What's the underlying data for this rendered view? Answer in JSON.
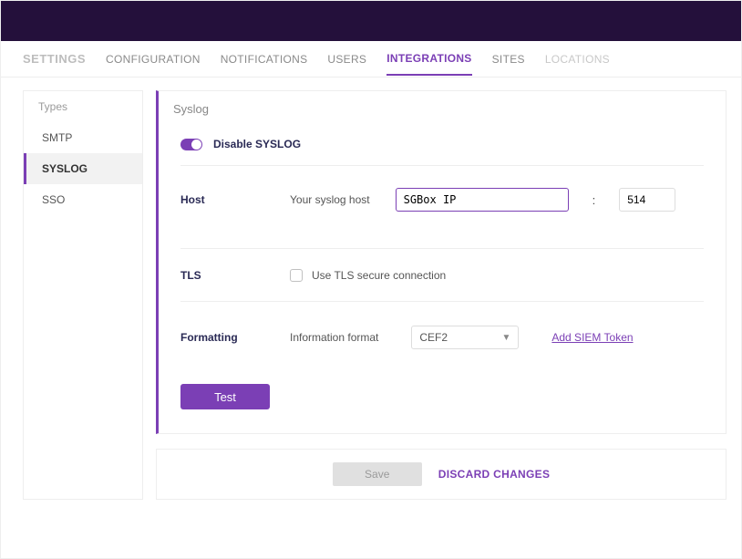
{
  "header": {
    "title": "SETTINGS",
    "tabs": [
      "CONFIGURATION",
      "NOTIFICATIONS",
      "USERS",
      "INTEGRATIONS",
      "SITES",
      "LOCATIONS"
    ],
    "active_tab": "INTEGRATIONS"
  },
  "sidebar": {
    "title": "Types",
    "items": [
      "SMTP",
      "SYSLOG",
      "SSO"
    ],
    "active": "SYSLOG"
  },
  "panel": {
    "title": "Syslog",
    "toggle_label": "Disable SYSLOG",
    "host": {
      "label": "Host",
      "sublabel": "Your syslog host",
      "value": "SGBox IP",
      "port": "514"
    },
    "tls": {
      "label": "TLS",
      "checkbox_label": "Use TLS secure connection",
      "checked": false
    },
    "formatting": {
      "label": "Formatting",
      "sublabel": "Information format",
      "value": "CEF2",
      "link": "Add SIEM Token"
    },
    "test_button": "Test"
  },
  "footer": {
    "save": "Save",
    "discard": "DISCARD CHANGES"
  }
}
